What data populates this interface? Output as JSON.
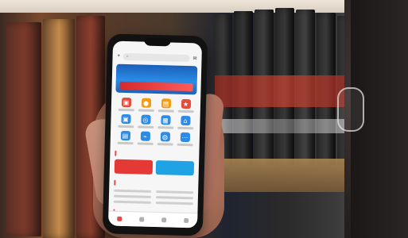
{
  "photo": {
    "description_visible": false
  },
  "phone_ui": {
    "status": {
      "time": "",
      "right": ""
    },
    "header": {
      "search_placeholder": ""
    },
    "banner": {
      "title": "",
      "subtitle": ""
    },
    "sections": [
      {
        "title": ""
      },
      {
        "title": ""
      },
      {
        "title": ""
      }
    ],
    "cards": [
      {
        "label": "",
        "color": "#e53935"
      },
      {
        "label": "",
        "color": "#1fa3e5"
      }
    ],
    "tab_colors": {
      "active": "#e44b4b",
      "inactive": "#b0b0b0"
    },
    "icons": [
      "icon-red",
      "icon-orange",
      "icon-orange",
      "icon-red",
      "icon-blue",
      "icon-blue",
      "icon-blue",
      "icon-blue",
      "icon-blue",
      "icon-blue",
      "icon-blue",
      "icon-blue"
    ]
  }
}
